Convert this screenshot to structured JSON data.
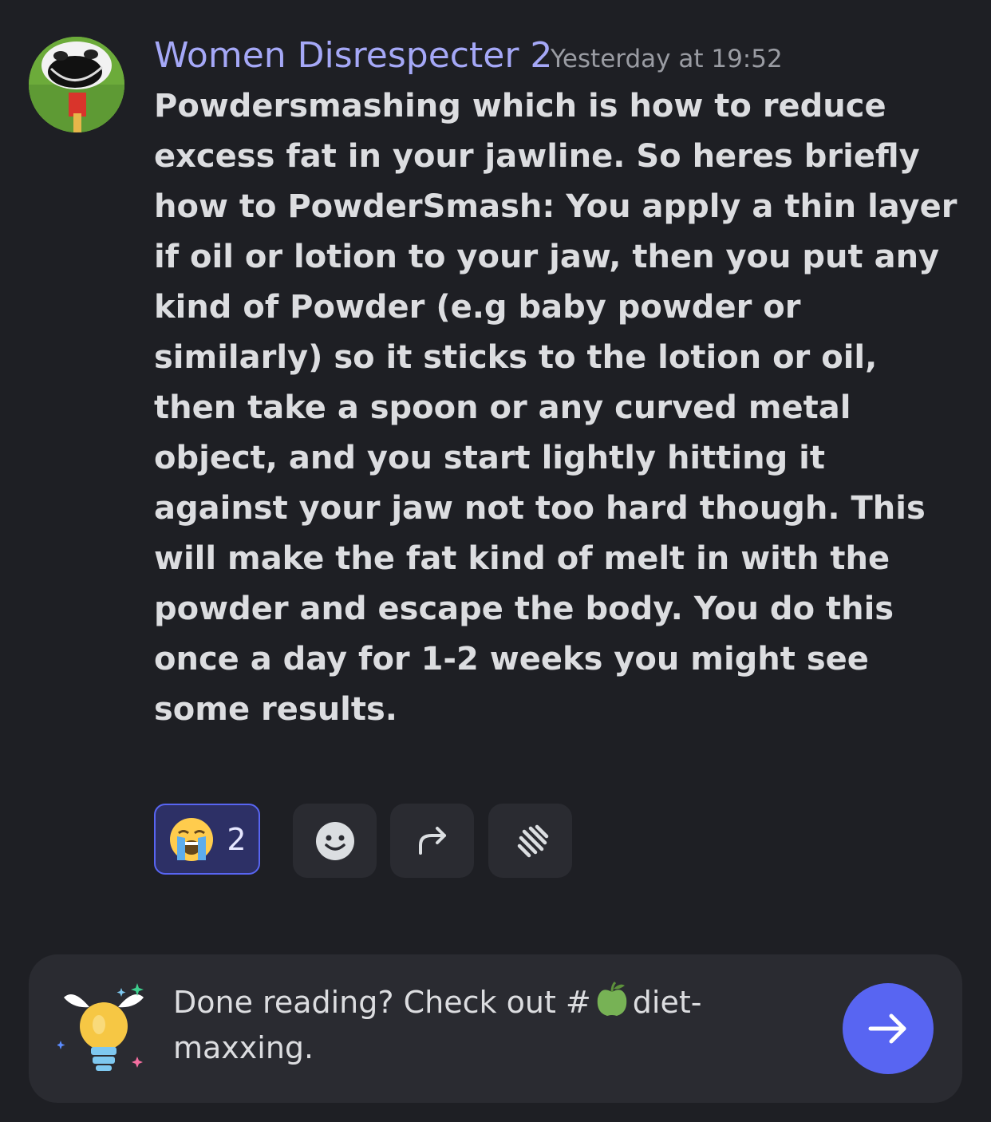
{
  "message": {
    "author": "Women Disrespecter 2",
    "timestamp": "Yesterday at 19:52",
    "content": "Powdersmashing which is how to reduce excess fat in your jawline. So heres briefly how to PowderSmash: You apply a thin layer if oil or lotion to your jaw, then you put any kind of Powder (e.g baby powder or similarly) so it sticks to the lotion or oil, then take a spoon or any curved metal object, and you start lightly hitting it against your jaw not too hard though. This will make the fat kind of melt in with the powder and escape the body. You do this once a day for 1-2 weeks you might see some results."
  },
  "reactions": [
    {
      "emoji": "loudly-crying-face",
      "count": "2",
      "selected": true
    }
  ],
  "actions": [
    {
      "name": "add-reaction",
      "icon": "smiley-face-icon"
    },
    {
      "name": "forward",
      "icon": "forward-arrow-icon"
    },
    {
      "name": "super-reaction",
      "icon": "burst-icon"
    }
  ],
  "banner": {
    "text_before": "Done reading? Check out #",
    "channel_emoji": "green-apple",
    "text_after": "diet-maxxing.",
    "mascot_icon": "winged-lightbulb-icon",
    "arrow_icon": "arrow-right-icon"
  },
  "colors": {
    "background": "#1e1f24",
    "username": "#a5a8f7",
    "accent": "#5865f2",
    "reaction_bg": "#2d3066",
    "button_bg": "#2a2b31"
  }
}
